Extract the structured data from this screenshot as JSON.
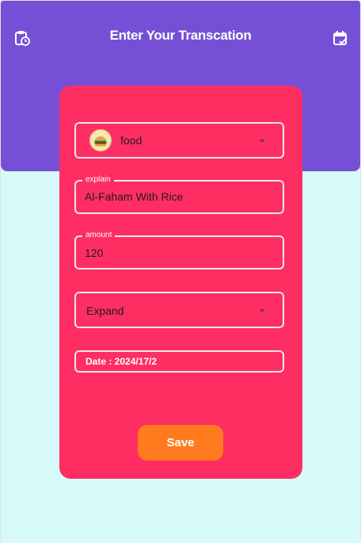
{
  "appbar": {
    "title": "Enter Your Transcation",
    "left_icon": "clipboard-clock-icon",
    "right_icon": "calendar-check-icon"
  },
  "form": {
    "category": {
      "icon": "burger-icon",
      "value": "food"
    },
    "explain": {
      "label": "explain",
      "value": "Al-Faham With  Rice"
    },
    "amount": {
      "label": "amount",
      "value": "120"
    },
    "type": {
      "value": "Expand"
    },
    "date": {
      "text": "Date : 2024/17/2"
    },
    "save_label": "Save"
  },
  "colors": {
    "appbar": "#7550d6",
    "background": "#d6fafa",
    "card": "#fe2e63",
    "save_button": "#ff7b1e"
  }
}
